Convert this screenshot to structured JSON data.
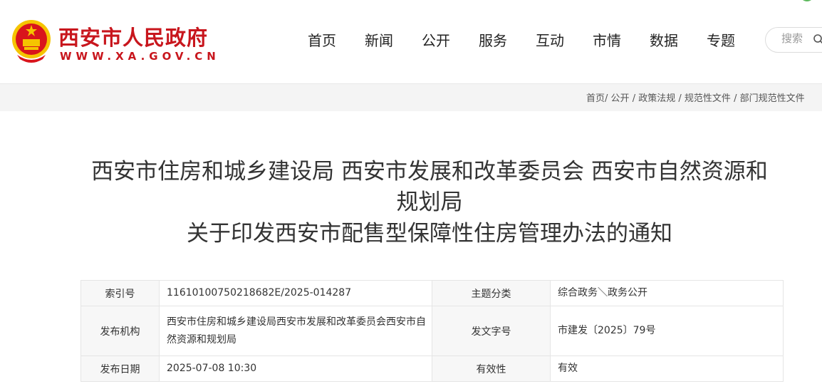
{
  "header": {
    "site_name": "西安市人民政府",
    "site_url": "WWW.XA.GOV.CN",
    "nav": [
      "首页",
      "新闻",
      "公开",
      "服务",
      "互动",
      "市情",
      "数据",
      "专题"
    ],
    "search": {
      "placeholder": "搜索"
    }
  },
  "breadcrumb": {
    "items": [
      "首页",
      "公开",
      "政策法规",
      "规范性文件",
      "部门规范性文件"
    ],
    "separator": "/"
  },
  "document": {
    "title_lines": [
      "西安市住房和城乡建设局 西安市发展和改革委员会 西安市自然资源和",
      "规划局",
      "关于印发西安市配售型保障性住房管理办法的通知"
    ],
    "meta": {
      "index_label": "索引号",
      "index_value": "11610100750218682E/2025-014287",
      "category_label": "主题分类",
      "category_value": "综合政务＼政务公开",
      "issuer_label": "发布机构",
      "issuer_value": "西安市住房和城乡建设局西安市发展和改革委员会西安市自然资源和规划局",
      "doc_no_label": "发文字号",
      "doc_no_value": "市建发〔2025〕79号",
      "date_label": "发布日期",
      "date_value": "2025-07-08 10:30",
      "validity_label": "有效性",
      "validity_value": "有效"
    }
  },
  "colors": {
    "brand_red": "#c8161d",
    "emblem_gold": "#f5c400",
    "page_bg": "#f4f4f4",
    "table_key_bg": "#f7f7f7"
  },
  "icons": [
    "national-emblem-icon",
    "search-icon"
  ]
}
